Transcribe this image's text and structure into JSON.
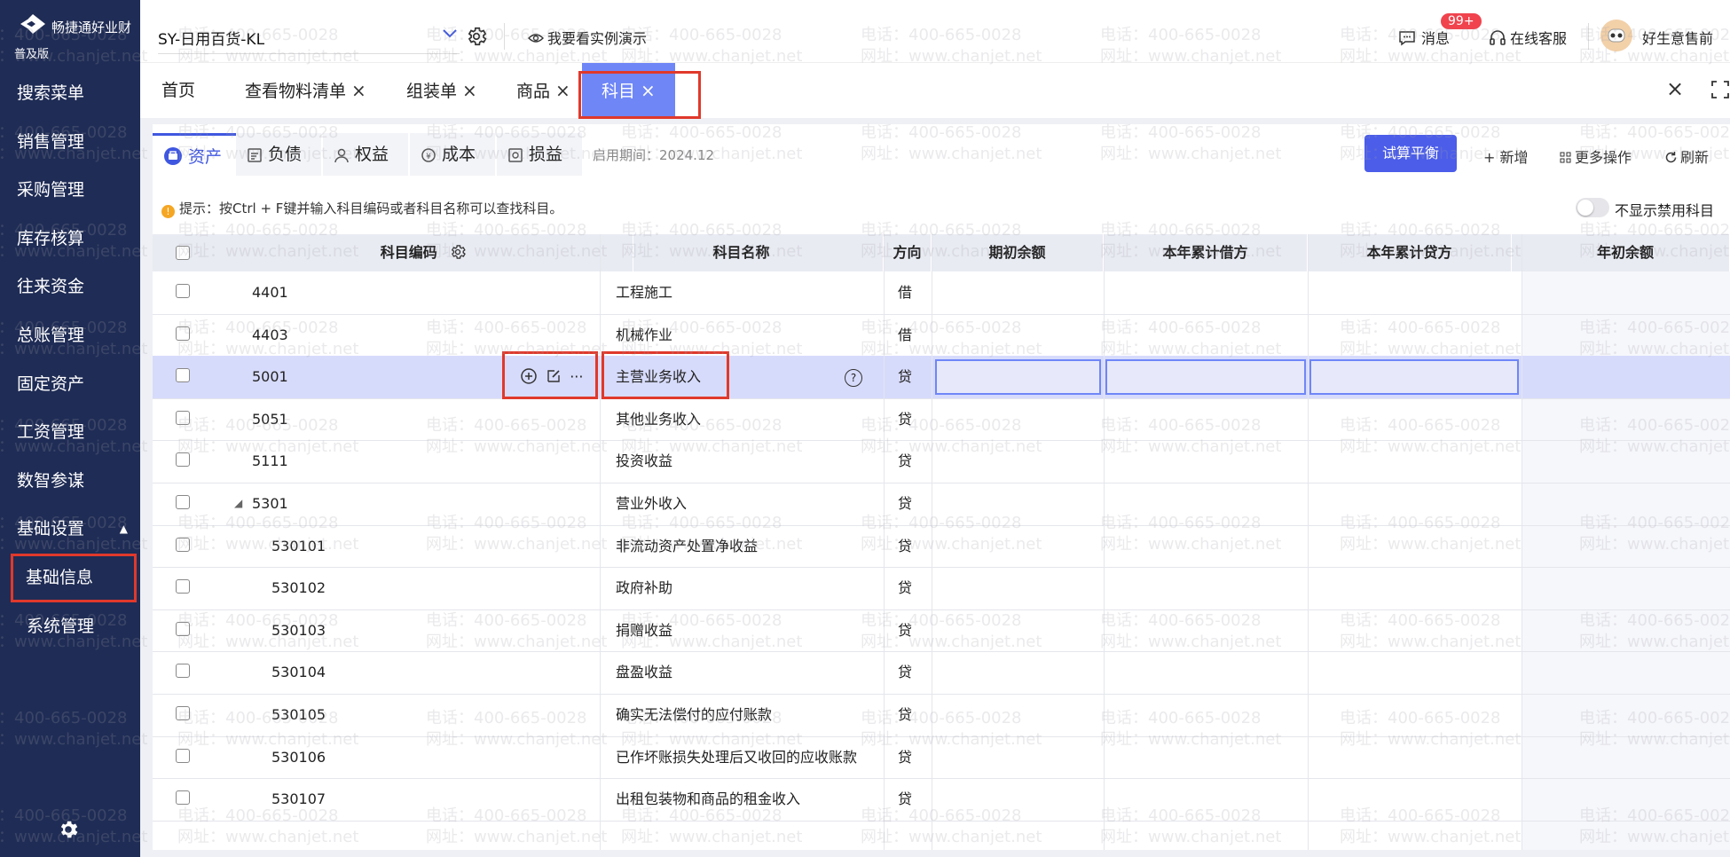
{
  "brand": {
    "name": "畅捷通好业财",
    "edition": "普及版"
  },
  "sidebar": {
    "items": [
      {
        "label": "搜索菜单"
      },
      {
        "label": "销售管理"
      },
      {
        "label": "采购管理"
      },
      {
        "label": "库存核算"
      },
      {
        "label": "往来资金"
      },
      {
        "label": "总账管理"
      },
      {
        "label": "固定资产"
      },
      {
        "label": "工资管理"
      },
      {
        "label": "数智参谋"
      },
      {
        "label": "基础设置",
        "caret": "▲"
      },
      {
        "label": "基础信息"
      },
      {
        "label": "系统管理"
      }
    ]
  },
  "header": {
    "company": "SY-日用百货-KL",
    "demo": "我要看实例演示",
    "messages": "消息",
    "badge": "99+",
    "service": "在线客服",
    "user": "好生意售前"
  },
  "tabs": [
    {
      "label": "首页"
    },
    {
      "label": "查看物料清单",
      "close": "×"
    },
    {
      "label": "组装单",
      "close": "×"
    },
    {
      "label": "商品",
      "close": "×"
    },
    {
      "label": "科目",
      "close": "×"
    }
  ],
  "tabbar": {
    "close_all": "×"
  },
  "subtabs": [
    {
      "label": "资产"
    },
    {
      "label": "负债"
    },
    {
      "label": "权益"
    },
    {
      "label": "成本"
    },
    {
      "label": "损益"
    }
  ],
  "toolbar": {
    "period": "启用期间：2024.12",
    "trial_balance": "试算平衡",
    "add": "+ 新增",
    "more": "更多操作",
    "refresh": "刷新"
  },
  "hint": {
    "icon": "!",
    "text": "提示：按Ctrl + F键并输入科目编码或者科目名称可以查找科目。"
  },
  "toggle": {
    "label": "不显示禁用科目"
  },
  "table": {
    "columns": [
      "科目编码",
      "科目名称",
      "方向",
      "期初余额",
      "本年累计借方",
      "本年累计贷方",
      "年初余额"
    ],
    "rows": [
      {
        "code": "4401",
        "name": "工程施工",
        "dir": "借"
      },
      {
        "code": "4403",
        "name": "机械作业",
        "dir": "借"
      },
      {
        "code": "5001",
        "name": "主营业务收入",
        "dir": "贷"
      },
      {
        "code": "5051",
        "name": "其他业务收入",
        "dir": "贷"
      },
      {
        "code": "5111",
        "name": "投资收益",
        "dir": "贷"
      },
      {
        "code": "5301",
        "name": "营业外收入",
        "dir": "贷",
        "expand": "◢"
      },
      {
        "code": "530101",
        "name": "非流动资产处置净收益",
        "dir": "贷"
      },
      {
        "code": "530102",
        "name": "政府补助",
        "dir": "贷"
      },
      {
        "code": "530103",
        "name": "捐赠收益",
        "dir": "贷"
      },
      {
        "code": "530104",
        "name": "盘盈收益",
        "dir": "贷"
      },
      {
        "code": "530105",
        "name": "确实无法偿付的应付账款",
        "dir": "贷"
      },
      {
        "code": "530106",
        "name": "已作坏账损失处理后又收回的应收账款",
        "dir": "贷"
      },
      {
        "code": "530107",
        "name": "出租包装物和商品的租金收入",
        "dir": "贷"
      }
    ]
  },
  "row_actions": {
    "more": "···"
  },
  "help": {
    "icon": "?"
  },
  "watermark": {
    "phone": "电话：400-665-0028",
    "site": "网址：www.chanjet.net"
  },
  "colors": {
    "sidebar": "#1f2c55",
    "accent": "#4b5de9",
    "active_tab": "#6f86f7",
    "highlight": "#e0392b",
    "hover_row": "#d7dbfb"
  }
}
